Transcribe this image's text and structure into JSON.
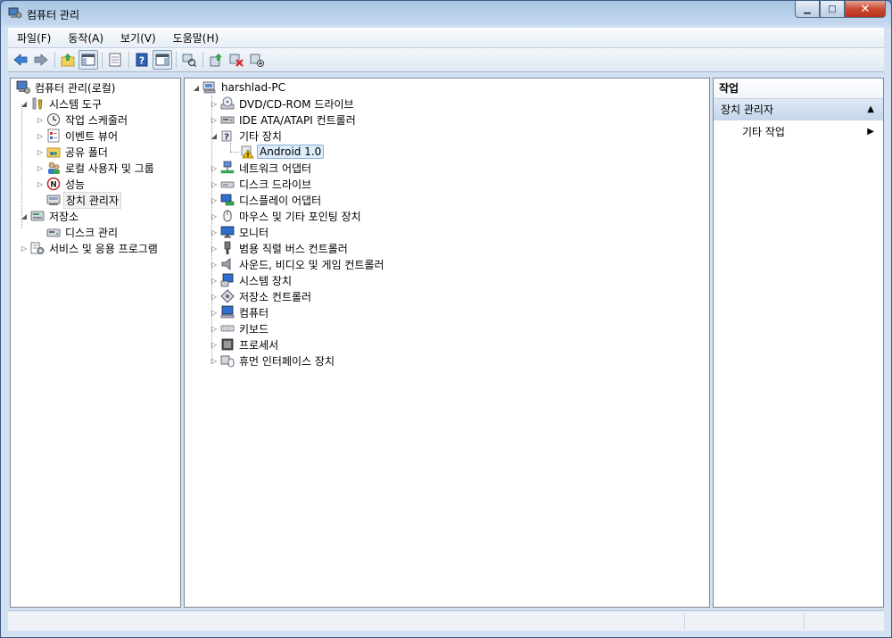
{
  "window": {
    "title": "컴퓨터 관리"
  },
  "window_buttons": {
    "minimize": "▁",
    "maximize": "□",
    "close": "✕"
  },
  "menubar": [
    "파일(F)",
    "동작(A)",
    "보기(V)",
    "도움말(H)"
  ],
  "toolbar_icons": [
    "back-icon",
    "forward-icon",
    "up-folder-icon",
    "show-hide-console-tree-icon",
    "properties-icon",
    "help-icon",
    "show-action-pane-icon",
    "scan-hardware-icon",
    "update-driver-icon",
    "uninstall-device-icon",
    "disable-device-icon"
  ],
  "left_tree": {
    "root": "컴퓨터 관리(로컬)",
    "system_tools": "시스템 도구",
    "task_scheduler": "작업 스케줄러",
    "event_viewer": "이벤트 뷰어",
    "shared_folders": "공유 폴더",
    "local_users": "로컬 사용자 및 그룹",
    "performance": "성능",
    "device_manager": "장치 관리자",
    "storage": "저장소",
    "disk_management": "디스크 관리",
    "services_apps": "서비스 및 응용 프로그램"
  },
  "device_tree": {
    "root": "harshlad-PC",
    "categories": [
      "DVD/CD-ROM 드라이브",
      "IDE ATA/ATAPI 컨트롤러",
      "기타 장치",
      "Android 1.0",
      "네트워크 어댑터",
      "디스크 드라이브",
      "디스플레이 어댑터",
      "마우스 및 기타 포인팅 장치",
      "모니터",
      "범용 직렬 버스 컨트롤러",
      "사운드, 비디오 및 게임 컨트롤러",
      "시스템 장치",
      "저장소 컨트롤러",
      "컴퓨터",
      "키보드",
      "프로세서",
      "휴먼 인터페이스 장치"
    ]
  },
  "actions": {
    "header": "작업",
    "group": "장치 관리자",
    "item": "기타 작업"
  },
  "colors": {
    "selection": "#ddecfb",
    "warning": "#f2c500",
    "accent": "#3b6ea5"
  }
}
